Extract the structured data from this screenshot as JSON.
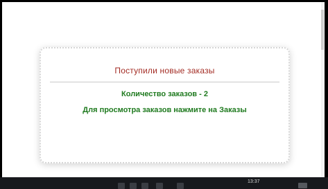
{
  "notification": {
    "title": "Поступили новые заказы",
    "count_text": "Количество заказов - 2",
    "hint_text": "Для просмотра заказов нажмите на Заказы"
  },
  "taskbar": {
    "clock": "13:37",
    "icons": [
      "app-icon",
      "app-icon",
      "app-icon",
      "app-icon",
      "app-icon"
    ]
  },
  "colors": {
    "title": "#a32c24",
    "body_text": "#1f7a1f",
    "taskbar": "#17191d"
  }
}
